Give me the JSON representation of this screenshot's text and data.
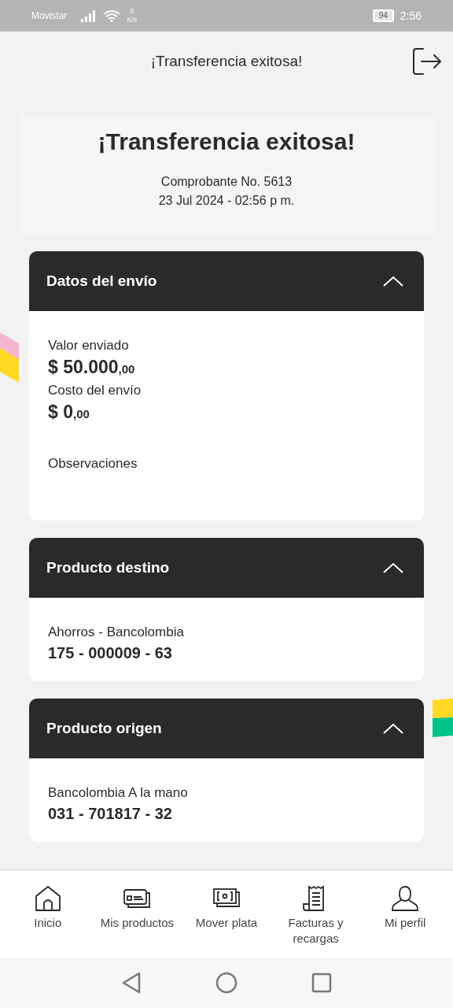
{
  "status_bar": {
    "carrier": "Movistar",
    "speed_value": "0",
    "speed_unit": "K/s",
    "battery": "94",
    "time": "2:56"
  },
  "header": {
    "title": "¡Transferencia exitosa!"
  },
  "summary": {
    "title": "¡Transferencia exitosa!",
    "receipt": "Comprobante No. 5613",
    "date": "23 Jul 2024 - 02:56 p m."
  },
  "sections": [
    {
      "title": "Datos del envío",
      "expanded": true,
      "items": [
        {
          "kind": "amount",
          "label": "Valor enviado",
          "value": "$ 50.000",
          "cents": ",00"
        },
        {
          "kind": "amount",
          "label": "Costo del envío",
          "value": "$ 0",
          "cents": ",00"
        },
        {
          "kind": "note",
          "label": "Observaciones"
        }
      ]
    },
    {
      "title": "Producto destino",
      "expanded": true,
      "items": [
        {
          "kind": "account",
          "label": "Ahorros - Bancolombia",
          "value": "175 - 000009 - 63"
        }
      ]
    },
    {
      "title": "Producto origen",
      "expanded": true,
      "items": [
        {
          "kind": "account",
          "label": "Bancolombia A la mano",
          "value": "031 - 701817 - 32"
        }
      ]
    }
  ],
  "bottom_nav": [
    {
      "kind": "home",
      "label": "Inicio"
    },
    {
      "kind": "cards",
      "label": "Mis productos"
    },
    {
      "kind": "money",
      "label": "Mover plata"
    },
    {
      "kind": "receipt",
      "label": "Facturas y recargas"
    },
    {
      "kind": "user",
      "label": "Mi perfil"
    }
  ]
}
